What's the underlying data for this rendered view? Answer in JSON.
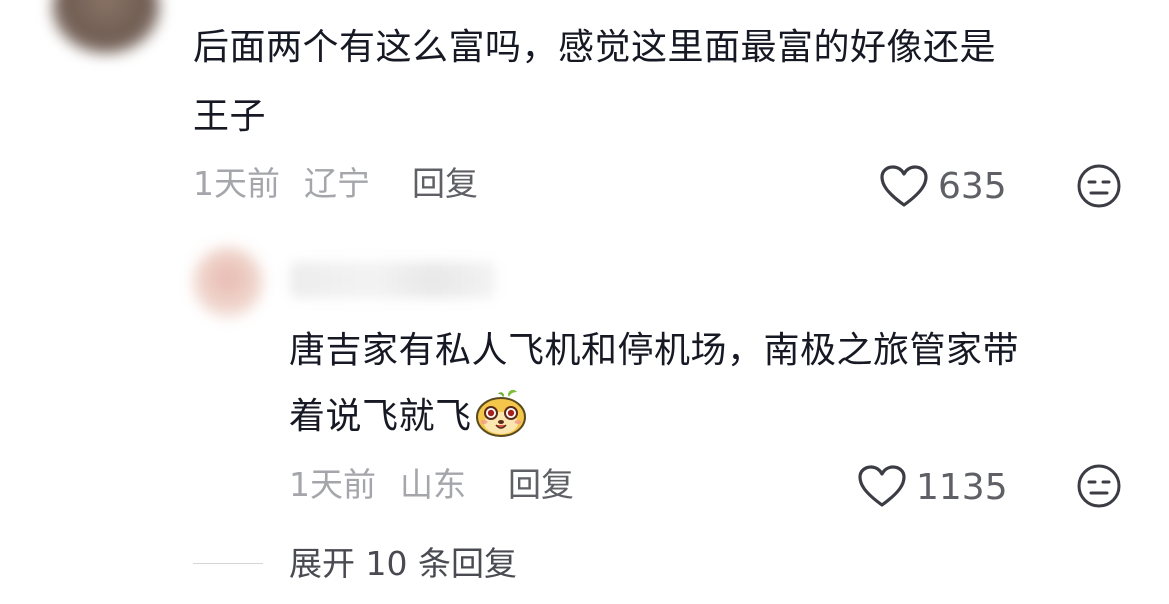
{
  "comment1": {
    "text_line1": "后面两个有这么富吗，感觉这里面最富的好像还是",
    "text_line2": "王子",
    "time": "1天前",
    "location": "辽宁",
    "reply_label": "回复",
    "likes": "635"
  },
  "reply1": {
    "text_line1": "唐吉家有私人飞机和停机场，南极之旅管家带",
    "text_line2": "着说飞就飞",
    "emoji": "smiling-face-emoji",
    "time": "1天前",
    "location": "山东",
    "reply_label": "回复",
    "likes": "1135"
  },
  "expand_replies": "展开 10 条回复",
  "icons": {
    "like": "heart-outline-icon",
    "dislike": "neutral-face-icon"
  },
  "colors": {
    "text": "#161823",
    "meta": "#a5a6ab",
    "action": "#5f6066"
  }
}
